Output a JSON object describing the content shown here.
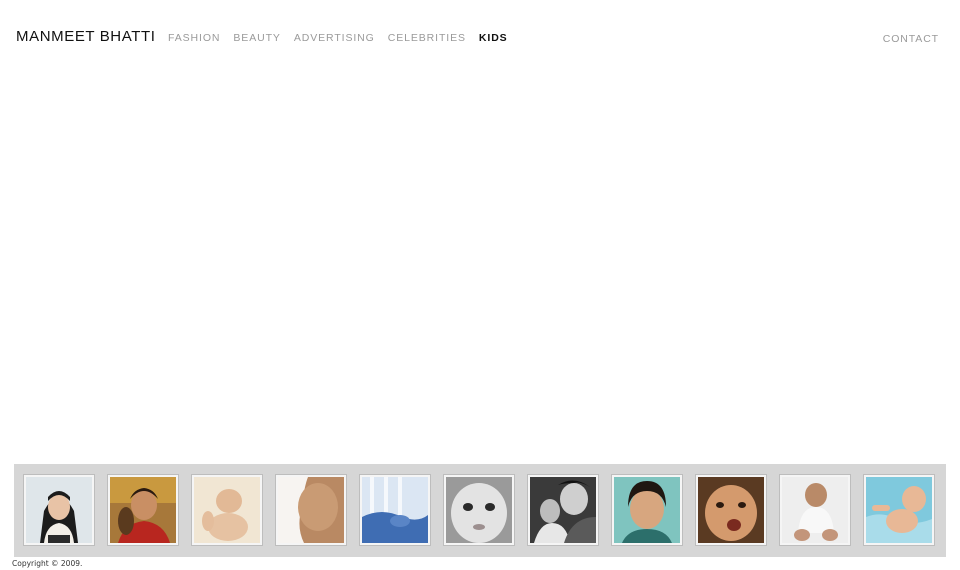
{
  "header": {
    "brand": "MANMEET BHATTI",
    "nav": [
      {
        "label": "FASHION",
        "active": false
      },
      {
        "label": "BEAUTY",
        "active": false
      },
      {
        "label": "ADVERTISING",
        "active": false
      },
      {
        "label": "CELEBRITIES",
        "active": false
      },
      {
        "label": "KIDS",
        "active": true
      }
    ],
    "contact": "CONTACT"
  },
  "footer": {
    "copyright": "Copyright © 2009."
  }
}
